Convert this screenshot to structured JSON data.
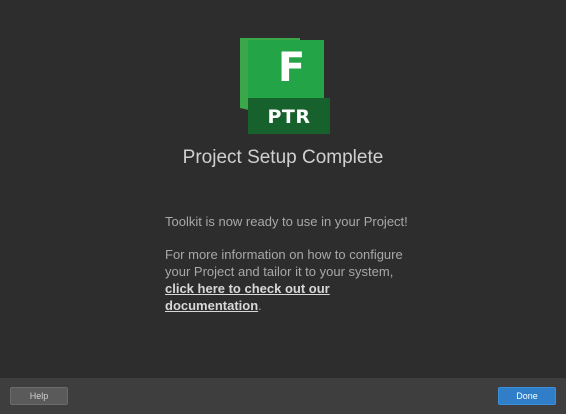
{
  "logo": {
    "letter": "F",
    "badge": "PTR",
    "colors": {
      "front": "#1b8a3a",
      "back": "#3aa84a",
      "badge": "#17622c"
    }
  },
  "title": "Project Setup Complete",
  "body": {
    "line1": "Toolkit is now ready to use in your Project!",
    "line2_prefix": "For more information on how to configure your Project and tailor it to your system, ",
    "link_text_1": "click here to check out our documentation",
    "line2_suffix": "."
  },
  "footer": {
    "help_label": "Help",
    "done_label": "Done"
  }
}
